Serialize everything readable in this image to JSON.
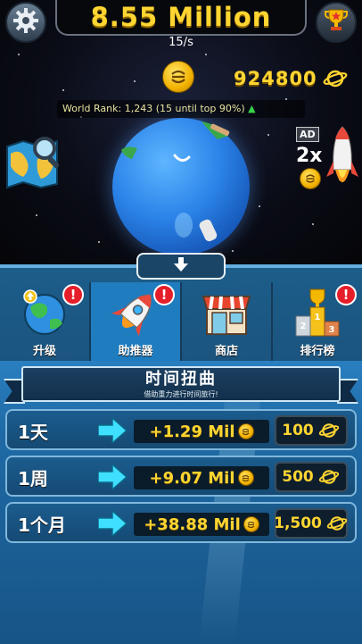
{
  "header": {
    "money": "8.55 Million",
    "rate": "15/s",
    "gems": "924800",
    "rank_text": "World Rank: 1,243 (15 until top 90%)",
    "rank_arrow": "▲"
  },
  "ad_boost": {
    "badge": "AD",
    "multiplier": "2x"
  },
  "tabs": [
    {
      "label": "升级",
      "icon": "globe-icon",
      "alert": "!"
    },
    {
      "label": "助推器",
      "icon": "rocket-icon",
      "alert": "!"
    },
    {
      "label": "商店",
      "icon": "store-icon",
      "alert": "!"
    },
    {
      "label": "排行榜",
      "icon": "podium-icon",
      "alert": "!"
    }
  ],
  "section": {
    "title": "时间扭曲",
    "subtitle": "借助重力进行时间旅行!"
  },
  "time_warps": [
    {
      "duration": "1天",
      "reward": "+1.29 Mil",
      "cost": "100"
    },
    {
      "duration": "1周",
      "reward": "+9.07 Mil",
      "cost": "500"
    },
    {
      "duration": "1个月",
      "reward": "+38.88 Mil",
      "cost": "1,500"
    }
  ],
  "colors": {
    "gold": "#ffd531",
    "panel_blue": "#1d5d8a",
    "active_tab": "#1f7cbf",
    "alert_red": "#e51e2a",
    "arrow_cyan": "#3fe0ff"
  }
}
